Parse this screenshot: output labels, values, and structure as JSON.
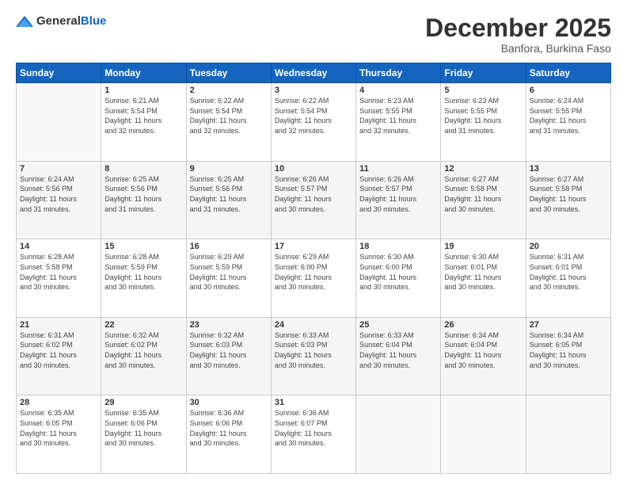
{
  "header": {
    "logo_general": "General",
    "logo_blue": "Blue",
    "month": "December 2025",
    "location": "Banfora, Burkina Faso"
  },
  "days_of_week": [
    "Sunday",
    "Monday",
    "Tuesday",
    "Wednesday",
    "Thursday",
    "Friday",
    "Saturday"
  ],
  "weeks": [
    [
      {
        "day": "",
        "info": ""
      },
      {
        "day": "1",
        "info": "Sunrise: 6:21 AM\nSunset: 5:54 PM\nDaylight: 11 hours\nand 32 minutes."
      },
      {
        "day": "2",
        "info": "Sunrise: 6:22 AM\nSunset: 5:54 PM\nDaylight: 11 hours\nand 32 minutes."
      },
      {
        "day": "3",
        "info": "Sunrise: 6:22 AM\nSunset: 5:54 PM\nDaylight: 11 hours\nand 32 minutes."
      },
      {
        "day": "4",
        "info": "Sunrise: 6:23 AM\nSunset: 5:55 PM\nDaylight: 11 hours\nand 32 minutes."
      },
      {
        "day": "5",
        "info": "Sunrise: 6:23 AM\nSunset: 5:55 PM\nDaylight: 11 hours\nand 31 minutes."
      },
      {
        "day": "6",
        "info": "Sunrise: 6:24 AM\nSunset: 5:55 PM\nDaylight: 11 hours\nand 31 minutes."
      }
    ],
    [
      {
        "day": "7",
        "info": "Sunrise: 6:24 AM\nSunset: 5:56 PM\nDaylight: 11 hours\nand 31 minutes."
      },
      {
        "day": "8",
        "info": "Sunrise: 6:25 AM\nSunset: 5:56 PM\nDaylight: 11 hours\nand 31 minutes."
      },
      {
        "day": "9",
        "info": "Sunrise: 6:25 AM\nSunset: 5:56 PM\nDaylight: 11 hours\nand 31 minutes."
      },
      {
        "day": "10",
        "info": "Sunrise: 6:26 AM\nSunset: 5:57 PM\nDaylight: 11 hours\nand 30 minutes."
      },
      {
        "day": "11",
        "info": "Sunrise: 6:26 AM\nSunset: 5:57 PM\nDaylight: 11 hours\nand 30 minutes."
      },
      {
        "day": "12",
        "info": "Sunrise: 6:27 AM\nSunset: 5:58 PM\nDaylight: 11 hours\nand 30 minutes."
      },
      {
        "day": "13",
        "info": "Sunrise: 6:27 AM\nSunset: 5:58 PM\nDaylight: 11 hours\nand 30 minutes."
      }
    ],
    [
      {
        "day": "14",
        "info": "Sunrise: 6:28 AM\nSunset: 5:58 PM\nDaylight: 11 hours\nand 30 minutes."
      },
      {
        "day": "15",
        "info": "Sunrise: 6:28 AM\nSunset: 5:59 PM\nDaylight: 11 hours\nand 30 minutes."
      },
      {
        "day": "16",
        "info": "Sunrise: 6:29 AM\nSunset: 5:59 PM\nDaylight: 11 hours\nand 30 minutes."
      },
      {
        "day": "17",
        "info": "Sunrise: 6:29 AM\nSunset: 6:00 PM\nDaylight: 11 hours\nand 30 minutes."
      },
      {
        "day": "18",
        "info": "Sunrise: 6:30 AM\nSunset: 6:00 PM\nDaylight: 11 hours\nand 30 minutes."
      },
      {
        "day": "19",
        "info": "Sunrise: 6:30 AM\nSunset: 6:01 PM\nDaylight: 11 hours\nand 30 minutes."
      },
      {
        "day": "20",
        "info": "Sunrise: 6:31 AM\nSunset: 6:01 PM\nDaylight: 11 hours\nand 30 minutes."
      }
    ],
    [
      {
        "day": "21",
        "info": "Sunrise: 6:31 AM\nSunset: 6:02 PM\nDaylight: 11 hours\nand 30 minutes."
      },
      {
        "day": "22",
        "info": "Sunrise: 6:32 AM\nSunset: 6:02 PM\nDaylight: 11 hours\nand 30 minutes."
      },
      {
        "day": "23",
        "info": "Sunrise: 6:32 AM\nSunset: 6:03 PM\nDaylight: 11 hours\nand 30 minutes."
      },
      {
        "day": "24",
        "info": "Sunrise: 6:33 AM\nSunset: 6:03 PM\nDaylight: 11 hours\nand 30 minutes."
      },
      {
        "day": "25",
        "info": "Sunrise: 6:33 AM\nSunset: 6:04 PM\nDaylight: 11 hours\nand 30 minutes."
      },
      {
        "day": "26",
        "info": "Sunrise: 6:34 AM\nSunset: 6:04 PM\nDaylight: 11 hours\nand 30 minutes."
      },
      {
        "day": "27",
        "info": "Sunrise: 6:34 AM\nSunset: 6:05 PM\nDaylight: 11 hours\nand 30 minutes."
      }
    ],
    [
      {
        "day": "28",
        "info": "Sunrise: 6:35 AM\nSunset: 6:05 PM\nDaylight: 11 hours\nand 30 minutes."
      },
      {
        "day": "29",
        "info": "Sunrise: 6:35 AM\nSunset: 6:06 PM\nDaylight: 11 hours\nand 30 minutes."
      },
      {
        "day": "30",
        "info": "Sunrise: 6:36 AM\nSunset: 6:06 PM\nDaylight: 11 hours\nand 30 minutes."
      },
      {
        "day": "31",
        "info": "Sunrise: 6:36 AM\nSunset: 6:07 PM\nDaylight: 11 hours\nand 30 minutes."
      },
      {
        "day": "",
        "info": ""
      },
      {
        "day": "",
        "info": ""
      },
      {
        "day": "",
        "info": ""
      }
    ]
  ]
}
